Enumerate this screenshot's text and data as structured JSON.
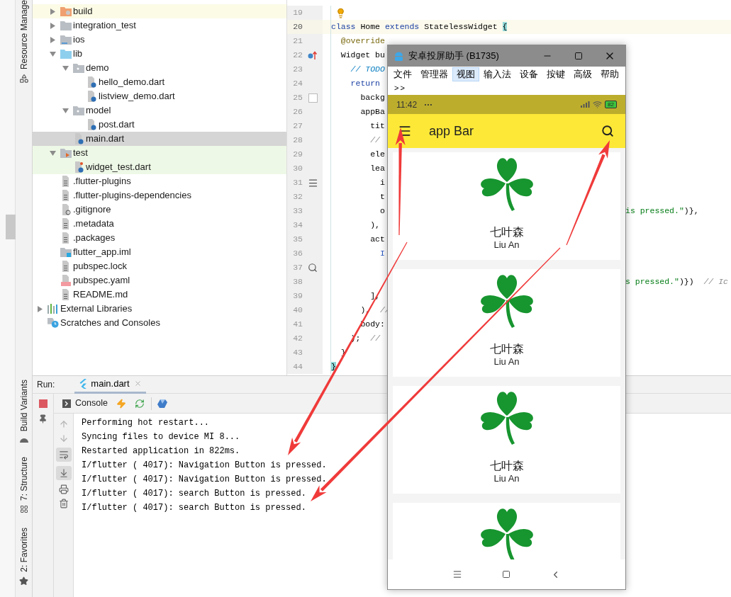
{
  "tool_windows": [
    {
      "label": "Resource Manage",
      "kind": "resources"
    },
    {
      "label": "Build Variants",
      "kind": "build"
    },
    {
      "label": "7: Structure",
      "kind": "structure"
    },
    {
      "label": "2: Favorites",
      "kind": "favorites"
    }
  ],
  "project_tree": {
    "items": [
      {
        "label": "build",
        "kind": "folder_excluded",
        "expanded": false,
        "selected": false,
        "color": "#fcfbe6"
      },
      {
        "label": "integration_test",
        "kind": "folder",
        "expanded": false,
        "selected": false
      },
      {
        "label": "ios",
        "kind": "folder_ios",
        "expanded": false,
        "selected": false
      },
      {
        "label": "lib",
        "kind": "folder_source",
        "expanded": true,
        "selected": false,
        "children": [
          {
            "label": "demo",
            "kind": "folder_package",
            "expanded": true,
            "selected": false,
            "children": [
              {
                "label": "hello_demo.dart",
                "kind": "dart",
                "selected": false
              },
              {
                "label": "listview_demo.dart",
                "kind": "dart",
                "selected": false
              }
            ]
          },
          {
            "label": "model",
            "kind": "folder_package",
            "expanded": true,
            "selected": false,
            "children": [
              {
                "label": "post.dart",
                "kind": "dart",
                "selected": false
              }
            ]
          },
          {
            "label": "main.dart",
            "kind": "dart",
            "selected": true
          }
        ]
      },
      {
        "label": "test",
        "kind": "folder_test",
        "expanded": true,
        "selected": false,
        "color": "#eef8e6",
        "children": [
          {
            "label": "widget_test.dart",
            "kind": "dart_test",
            "selected": false,
            "color": "#eef8e6"
          }
        ]
      },
      {
        "label": ".flutter-plugins",
        "kind": "text",
        "selected": false
      },
      {
        "label": ".flutter-plugins-dependencies",
        "kind": "text",
        "selected": false
      },
      {
        "label": ".gitignore",
        "kind": "ignore",
        "selected": false
      },
      {
        "label": ".metadata",
        "kind": "text",
        "selected": false
      },
      {
        "label": ".packages",
        "kind": "text",
        "selected": false
      },
      {
        "label": "flutter_app.iml",
        "kind": "module",
        "selected": false
      },
      {
        "label": "pubspec.lock",
        "kind": "text",
        "selected": false
      },
      {
        "label": "pubspec.yaml",
        "kind": "yaml",
        "selected": false
      },
      {
        "label": "README.md",
        "kind": "text",
        "selected": false
      }
    ],
    "roots": [
      {
        "label": "External Libraries",
        "kind": "libraries",
        "expanded": false,
        "selected": false
      },
      {
        "label": "Scratches and Consoles",
        "kind": "scratches",
        "selected": false
      }
    ]
  },
  "editor": {
    "lines": [
      {
        "number": "19",
        "current": false,
        "kind": "bulb"
      },
      {
        "number": "20",
        "current": true,
        "code": [
          {
            "kind": "keyword",
            "text": "class"
          },
          {
            "kind": "plain",
            "text": " Home "
          },
          {
            "kind": "keyword",
            "text": "extends"
          },
          {
            "kind": "plain",
            "text": " StatelessWidget "
          },
          {
            "kind": "brace",
            "text": "{"
          }
        ]
      },
      {
        "number": "21",
        "current": false,
        "code": [
          {
            "kind": "annotation",
            "text": "  @override"
          }
        ]
      },
      {
        "number": "22",
        "current": false,
        "kind": "override",
        "code": [
          {
            "kind": "plain",
            "text": "  Widget bu"
          }
        ]
      },
      {
        "number": "23",
        "current": false,
        "code": [
          {
            "kind": "todo",
            "text": "    // TODO"
          }
        ]
      },
      {
        "number": "24",
        "current": false,
        "code": [
          {
            "kind": "keyword",
            "text": "    return"
          }
        ]
      },
      {
        "number": "25",
        "current": false,
        "kind": "color_box",
        "code": [
          {
            "kind": "plain",
            "text": "      backg"
          }
        ]
      },
      {
        "number": "26",
        "current": false,
        "code": [
          {
            "kind": "plain",
            "text": "      appBa"
          }
        ]
      },
      {
        "number": "27",
        "current": false,
        "code": [
          {
            "kind": "plain",
            "text": "        tit"
          }
        ]
      },
      {
        "number": "28",
        "current": false,
        "code": [
          {
            "kind": "comment",
            "text": "        //"
          }
        ]
      },
      {
        "number": "29",
        "current": false,
        "code": [
          {
            "kind": "plain",
            "text": "        ele"
          }
        ]
      },
      {
        "number": "30",
        "current": false,
        "code": [
          {
            "kind": "plain",
            "text": "        lea"
          }
        ]
      },
      {
        "number": "31",
        "current": false,
        "kind": "list",
        "code": [
          {
            "kind": "plain",
            "text": "          i"
          }
        ]
      },
      {
        "number": "32",
        "current": false,
        "code": [
          {
            "kind": "plain",
            "text": "          t"
          }
        ]
      },
      {
        "number": "33",
        "current": false,
        "code": [
          {
            "kind": "plain",
            "text": "          o"
          }
        ],
        "code_right": [
          {
            "kind": "string",
            "text": "is pressed.\""
          },
          {
            "kind": "plain",
            "text": ")},"
          }
        ]
      },
      {
        "number": "34",
        "current": false,
        "code": [
          {
            "kind": "plain",
            "text": "        ),"
          }
        ]
      },
      {
        "number": "35",
        "current": false,
        "code": [
          {
            "kind": "plain",
            "text": "        act"
          }
        ]
      },
      {
        "number": "36",
        "current": false,
        "code": [
          {
            "kind": "type",
            "text": "          I"
          }
        ]
      },
      {
        "number": "37",
        "current": false,
        "kind": "search"
      },
      {
        "number": "38",
        "current": false,
        "code_right": [
          {
            "kind": "string",
            "text": "s pressed.\""
          },
          {
            "kind": "plain",
            "text": ")})"
          },
          {
            "kind": "comment",
            "text": "  // Ic"
          }
        ]
      },
      {
        "number": "39",
        "current": false,
        "code": [
          {
            "kind": "plain",
            "text": "        ],"
          }
        ]
      },
      {
        "number": "40",
        "current": false,
        "code": [
          {
            "kind": "plain",
            "text": "      ),"
          },
          {
            "kind": "comment",
            "text": "  //"
          }
        ]
      },
      {
        "number": "41",
        "current": false,
        "code": [
          {
            "kind": "plain",
            "text": "      body:"
          }
        ]
      },
      {
        "number": "42",
        "current": false,
        "code": [
          {
            "kind": "plain",
            "text": "    );"
          },
          {
            "kind": "comment",
            "text": "  //"
          }
        ]
      },
      {
        "number": "43",
        "current": false,
        "code": [
          {
            "kind": "plain",
            "text": "  }"
          }
        ]
      },
      {
        "number": "44",
        "current": false,
        "code": [
          {
            "kind": "brace",
            "text": "}"
          }
        ]
      }
    ]
  },
  "device_window": {
    "title": "安卓投屏助手 (B1735)",
    "menu": [
      {
        "label": "文件",
        "selected": false
      },
      {
        "label": "管理器",
        "selected": false
      },
      {
        "label": "视图",
        "selected": true
      },
      {
        "label": "输入法",
        "selected": false
      },
      {
        "label": "设备",
        "selected": false
      },
      {
        "label": "按键",
        "selected": false
      },
      {
        "label": "高级",
        "selected": false
      },
      {
        "label": "帮助",
        "selected": false
      }
    ],
    "overflow": ">>",
    "status_bar": {
      "time": "11:42",
      "more": "···",
      "battery": "82"
    },
    "app_bar": {
      "title": "app Bar"
    },
    "cards": [
      {
        "kind": "full",
        "title": "七叶森",
        "subtitle": "Liu An"
      },
      {
        "kind": "full",
        "title": "七叶森",
        "subtitle": "Liu An"
      },
      {
        "kind": "full",
        "title": "七叶森",
        "subtitle": "Liu An"
      },
      {
        "kind": "cut"
      }
    ]
  },
  "run_panel": {
    "label": "Run:",
    "tabs": [
      {
        "label": "main.dart",
        "selected": true
      }
    ],
    "console_tab": "Console",
    "output": [
      "Performing hot restart...",
      "Syncing files to device MI 8...",
      "Restarted application in 822ms.",
      "I/flutter ( 4017): Navigation Button is pressed.",
      "I/flutter ( 4017): Navigation Button is pressed.",
      "I/flutter ( 4017): search Button is pressed.",
      "I/flutter ( 4017): search Button is pressed."
    ]
  }
}
